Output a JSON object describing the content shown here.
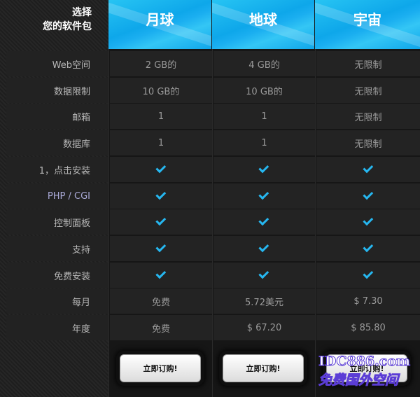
{
  "header": {
    "line1": "选择",
    "line2": "您的软件包"
  },
  "plans": [
    {
      "name": "月球"
    },
    {
      "name": "地球"
    },
    {
      "name": "宇宙"
    }
  ],
  "rows": [
    {
      "label": "Web空间",
      "values": [
        "2 GB的",
        "4 GB的",
        "无限制"
      ]
    },
    {
      "label": "数据限制",
      "values": [
        "10 GB的",
        "10 GB的",
        "无限制"
      ]
    },
    {
      "label": "邮箱",
      "values": [
        "1",
        "1",
        "无限制"
      ]
    },
    {
      "label": "数据库",
      "values": [
        "1",
        "1",
        "无限制"
      ]
    },
    {
      "label": "1，点击安装",
      "values": [
        "check",
        "check",
        "check"
      ]
    },
    {
      "label": "PHP / CGI",
      "values": [
        "check",
        "check",
        "check"
      ]
    },
    {
      "label": "控制面板",
      "values": [
        "check",
        "check",
        "check"
      ]
    },
    {
      "label": "支持",
      "values": [
        "check",
        "check",
        "check"
      ]
    },
    {
      "label": "免费安装",
      "values": [
        "check",
        "check",
        "check"
      ]
    },
    {
      "label": "每月",
      "values": [
        "免费",
        "5.72美元",
        "$ 7.30"
      ]
    },
    {
      "label": "年度",
      "values": [
        "免费",
        "$ 67.20",
        "$ 85.80"
      ]
    }
  ],
  "order_button_label": "立即订购!",
  "watermark": {
    "line1": "IDC886.com",
    "line2": "免费国外空间"
  },
  "colors": {
    "accent": "#26b7f0",
    "header_bg": "#0ea7ea"
  }
}
